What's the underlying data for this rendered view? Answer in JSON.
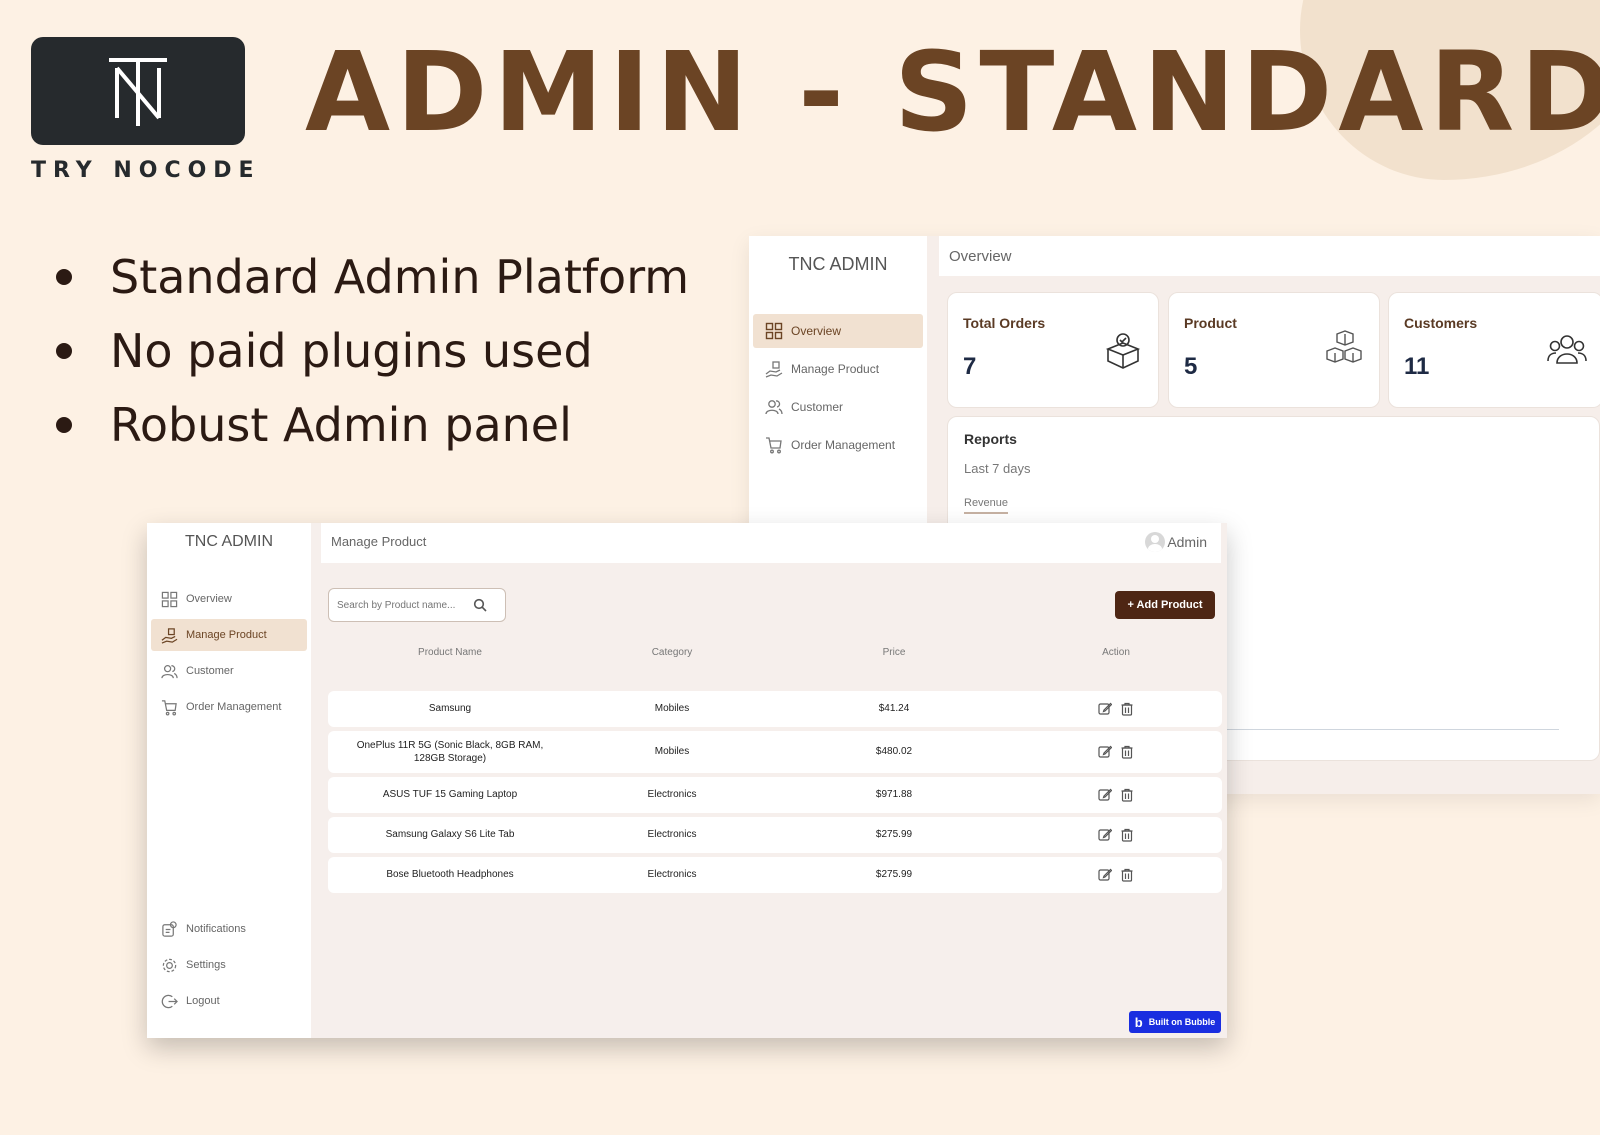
{
  "header": {
    "logo_text": "TRY NOCODE",
    "title": "ADMIN - STANDARD"
  },
  "bullets": [
    "Standard Admin Platform",
    "No paid plugins used",
    "Robust Admin panel"
  ],
  "overview_window": {
    "brand": "TNC ADMIN",
    "nav": [
      {
        "label": "Overview",
        "icon": "grid-icon",
        "active": true
      },
      {
        "label": "Manage Product",
        "icon": "hand-box-icon",
        "active": false
      },
      {
        "label": "Customer",
        "icon": "users-icon",
        "active": false
      },
      {
        "label": "Order Management",
        "icon": "cart-icon",
        "active": false
      }
    ],
    "page_title": "Overview",
    "cards": [
      {
        "title": "Total Orders",
        "value": "7",
        "icon": "order-box-icon"
      },
      {
        "title": "Product",
        "value": "5",
        "icon": "boxes-icon"
      },
      {
        "title": "Customers",
        "value": "11",
        "icon": "people-icon"
      }
    ],
    "reports": {
      "title": "Reports",
      "range": "Last 7 days",
      "tab": "Revenue"
    }
  },
  "product_window": {
    "brand": "TNC ADMIN",
    "nav": [
      {
        "label": "Overview",
        "icon": "grid-icon",
        "active": false
      },
      {
        "label": "Manage Product",
        "icon": "hand-box-icon",
        "active": true
      },
      {
        "label": "Customer",
        "icon": "users-icon",
        "active": false
      },
      {
        "label": "Order Management",
        "icon": "cart-icon",
        "active": false
      }
    ],
    "bottom_nav": [
      {
        "label": "Notifications",
        "icon": "bell-icon"
      },
      {
        "label": "Settings",
        "icon": "gear-icon"
      },
      {
        "label": "Logout",
        "icon": "logout-icon"
      }
    ],
    "page_title": "Manage Product",
    "user": "Admin",
    "search_placeholder": "Search by Product name...",
    "add_button": "+ Add Product",
    "columns": [
      "Product Name",
      "Category",
      "Price",
      "Action"
    ],
    "rows": [
      {
        "name": "Samsung",
        "category": "Mobiles",
        "price": "$41.24"
      },
      {
        "name": "OnePlus 11R 5G (Sonic Black, 8GB RAM, 128GB Storage)",
        "category": "Mobiles",
        "price": "$480.02"
      },
      {
        "name": "ASUS TUF 15 Gaming Laptop",
        "category": "Electronics",
        "price": "$971.88"
      },
      {
        "name": "Samsung Galaxy S6 Lite Tab",
        "category": "Electronics",
        "price": "$275.99"
      },
      {
        "name": "Bose Bluetooth Headphones",
        "category": "Electronics",
        "price": "$275.99"
      }
    ],
    "badge": "Built on Bubble"
  },
  "colors": {
    "background": "#fdf1e4",
    "brand_brown": "#6b4424",
    "button_dark": "#4e2614",
    "bubble_blue": "#1a2ee0"
  }
}
